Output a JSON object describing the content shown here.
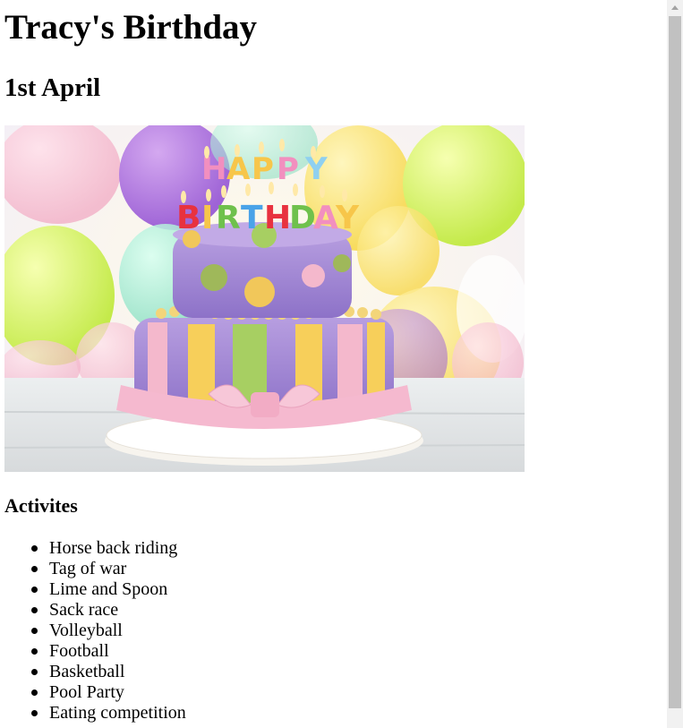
{
  "page": {
    "title": "Tracy's Birthday",
    "date": "1st April"
  },
  "hero_image": {
    "alt": "birthday cake",
    "candle_text_top": "HAPPY",
    "candle_text_bottom": "BIRTHDAY"
  },
  "activities": {
    "heading": "Activites",
    "items": [
      "Horse back riding",
      "Tag of war",
      "Lime and Spoon",
      "Sack race",
      "Volleyball",
      "Football",
      "Basketball",
      "Pool Party",
      "Eating competition"
    ]
  },
  "scrollbar": {
    "icon": "scroll-up-arrow"
  }
}
